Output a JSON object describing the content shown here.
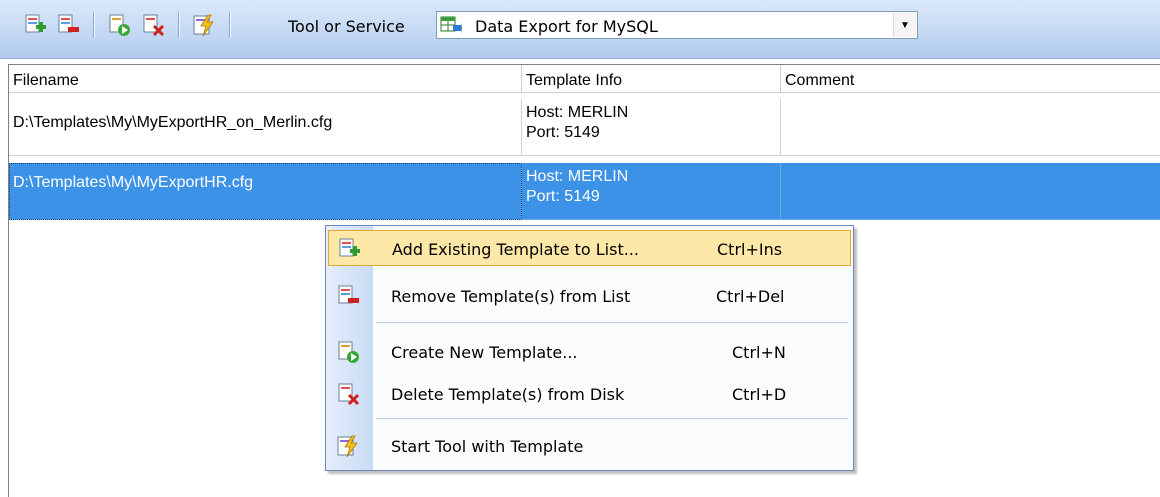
{
  "toolbar": {
    "tool_label": "Tool or Service",
    "selected_tool": "Data Export for MySQL",
    "buttons": [
      "add-template-icon",
      "remove-template-icon",
      "create-template-icon",
      "delete-template-icon",
      "start-tool-icon"
    ]
  },
  "grid": {
    "columns": [
      "Filename",
      "Template Info",
      "Comment"
    ],
    "rows": [
      {
        "filename": "D:\\Templates\\My\\MyExportHR_on_Merlin.cfg",
        "host": "Host: MERLIN",
        "port": "Port: 5149",
        "comment": ""
      },
      {
        "filename": "D:\\Templates\\My\\MyExportHR.cfg",
        "host": "Host: MERLIN",
        "port": "Port: 5149",
        "comment": ""
      }
    ],
    "selected_row": 1
  },
  "context_menu": {
    "items": [
      {
        "label": "Add Existing Template to List...",
        "shortcut": "Ctrl+Ins",
        "icon": "add-template-icon"
      },
      {
        "label": "Remove Template(s) from List",
        "shortcut": "Ctrl+Del",
        "icon": "remove-template-icon"
      },
      {
        "label": "Create New Template...",
        "shortcut": "Ctrl+N",
        "icon": "create-template-icon"
      },
      {
        "label": "Delete Template(s) from Disk",
        "shortcut": "Ctrl+D",
        "icon": "delete-template-icon"
      },
      {
        "label": "Start Tool with Template",
        "shortcut": "",
        "icon": "start-tool-icon"
      }
    ],
    "highlighted_index": 0
  },
  "colors": {
    "selection": "#3c92e6",
    "menu_highlight": "#fee8a8",
    "toolbar": "#c5d9f3"
  }
}
